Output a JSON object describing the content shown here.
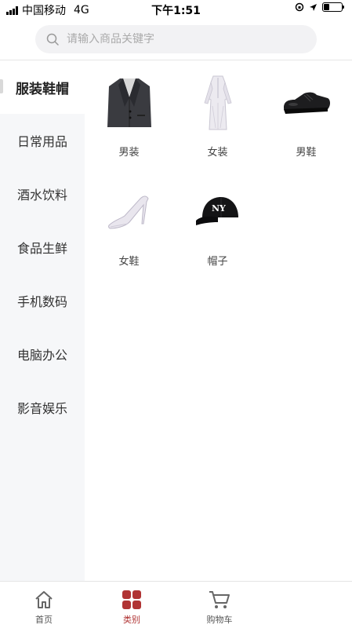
{
  "status": {
    "carrier": "中国移动",
    "network": "4G",
    "time": "下午1:51",
    "battery_level": 0.3
  },
  "search": {
    "placeholder": "请输入商品关键字",
    "icon": "search-icon"
  },
  "sidebar": {
    "items": [
      {
        "label": "服装鞋帽",
        "active": true
      },
      {
        "label": "日常用品"
      },
      {
        "label": "酒水饮料"
      },
      {
        "label": "食品生鲜"
      },
      {
        "label": "手机数码"
      },
      {
        "label": "电脑办公"
      },
      {
        "label": "影音娱乐"
      }
    ]
  },
  "products": [
    {
      "label": "男装",
      "icon": "suit-jacket-image"
    },
    {
      "label": "女装",
      "icon": "dress-image"
    },
    {
      "label": "男鞋",
      "icon": "leather-shoe-image"
    },
    {
      "label": "女鞋",
      "icon": "high-heel-image"
    },
    {
      "label": "帽子",
      "icon": "baseball-cap-image"
    }
  ],
  "tabbar": {
    "items": [
      {
        "label": "首页",
        "icon": "home-icon"
      },
      {
        "label": "类别",
        "icon": "category-icon",
        "active": true
      },
      {
        "label": "购物车",
        "icon": "cart-icon"
      }
    ],
    "active_color": "#b03434"
  }
}
